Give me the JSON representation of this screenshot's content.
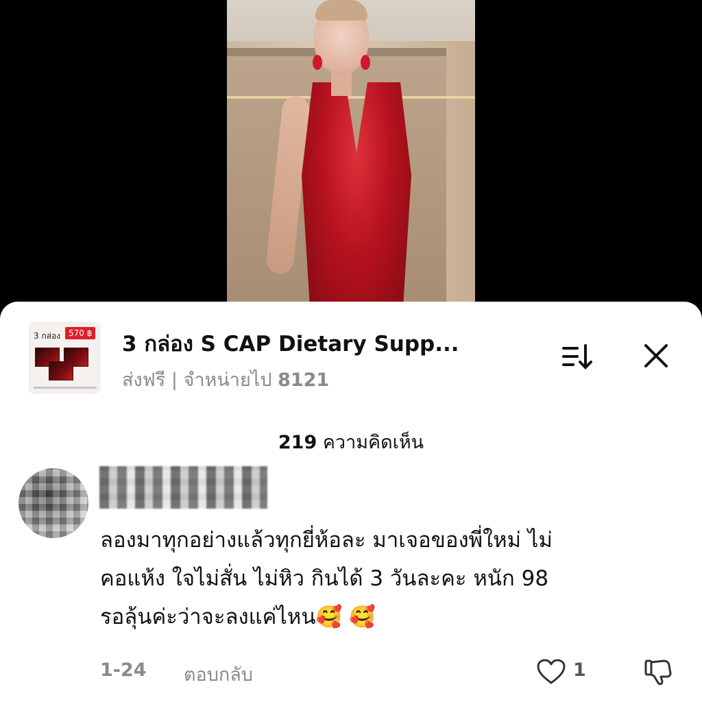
{
  "product": {
    "thumb_box_label": "3 กล่อง",
    "thumb_price": "570 ฿",
    "title": "3 กล่อง S CAP Dietary Supp...",
    "shipping": "ส่งฟรี | จำหน่ายไป ",
    "sold_count": "8121"
  },
  "comments_header": {
    "count": "219",
    "label": " ความคิดเห็น"
  },
  "comment": {
    "lines": [
      "ลองมาทุกอย่างแล้วทุกยี่ห้อละ มาเจอของพี่ใหม่ ไม่",
      "คอแห้ง ใจไม่สั่น ไม่หิว กินได้ 3 วันละคะ หนัก 98",
      "รอลุ้นค่ะว่าจะลงแค่ไหน🥰 🥰"
    ],
    "date": "1-24",
    "reply_label": "ตอบกลับ",
    "like_count": "1"
  },
  "icons": {
    "sort": "sort-descending-icon",
    "close": "close-icon",
    "like": "heart-outline-icon",
    "dislike": "thumbs-down-icon"
  },
  "colors": {
    "sheet_bg": "#ffffff",
    "price_badge": "#e11d2a",
    "secondary_text": "#8a8a8a"
  }
}
